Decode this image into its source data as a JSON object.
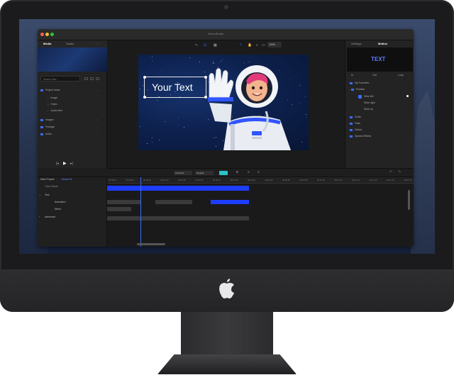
{
  "app": {
    "window_title": "DemoStudio",
    "left_tabs": [
      "Media",
      "Studio"
    ],
    "search_placeholder": "Search files...",
    "tree": [
      {
        "label": "Project name"
      },
      {
        "label": "Image"
      },
      {
        "label": "Video"
      },
      {
        "label": "Audio item"
      },
      {
        "label": "Images"
      },
      {
        "label": "Footage"
      },
      {
        "label": "Audio"
      }
    ],
    "zoom": "100%",
    "canvas_text": "Your Text",
    "playbar": {
      "selects": [
        "Helvetica",
        "Regular"
      ]
    },
    "right_tabs": [
      "Settings",
      "Motion"
    ],
    "right_preview_text": "TEXT",
    "right_subtabs": [
      "In",
      "Out",
      "Loop"
    ],
    "right_rows": [
      {
        "label": "My Favorites"
      },
      {
        "label": "Position"
      },
      {
        "label": "Slide left"
      },
      {
        "label": "Slide right"
      },
      {
        "label": "Slide up"
      },
      {
        "label": "Scale"
      },
      {
        "label": "Fade"
      },
      {
        "label": "Distort"
      },
      {
        "label": "Special Effects"
      }
    ],
    "timeline": {
      "tabs": [
        "Main Project",
        "Scene 01"
      ],
      "track_header": "Track Name",
      "rows": [
        "Text",
        "Animation",
        "Effect",
        "Astronaut"
      ],
      "ticks": [
        "00:00:00",
        "00:00:05",
        "00:00:10",
        "00:00:15",
        "00:00:20",
        "00:00:25",
        "00:00:30",
        "00:00:35",
        "00:00:40",
        "00:00:45",
        "00:00:50",
        "00:00:55",
        "00:01:00",
        "00:01:05",
        "00:01:10",
        "00:01:15",
        "00:01:20",
        "00:01:25"
      ]
    }
  },
  "colors": {
    "accent": "#1d3dff",
    "panel": "#232323",
    "canvas_bg": "#0e2250"
  }
}
